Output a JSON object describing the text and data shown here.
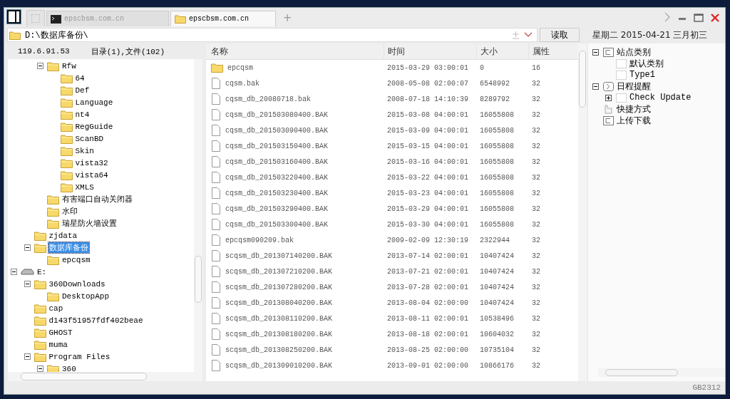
{
  "tabs": [
    {
      "kind": "blank",
      "selected": false
    },
    {
      "kind": "terminal",
      "label": "epscbsm.com.cn",
      "selected": false
    },
    {
      "kind": "folder",
      "label": "epscbsm.com.cn",
      "selected": true
    }
  ],
  "new_tab": "+",
  "address": {
    "path": "D:\\数据库备份\\",
    "button": "读取"
  },
  "date_line": "星期二 2015-04-21 三月初三",
  "left_panel": {
    "host": "119.6.91.53",
    "summary": "目录(1),文件(102)"
  },
  "tree": [
    {
      "children": [
        {
          "children": [
            {
              "label": "Rfw",
              "kind": "folder",
              "expanded": true,
              "selected": false,
              "children": [
                {
                  "label": "64",
                  "kind": "folder",
                  "selected": false
                },
                {
                  "label": "Def",
                  "kind": "folder",
                  "selected": false
                },
                {
                  "label": "Language",
                  "kind": "folder",
                  "selected": false
                },
                {
                  "label": "nt4",
                  "kind": "folder",
                  "selected": false
                },
                {
                  "label": "RegGuide",
                  "kind": "folder",
                  "selected": false
                },
                {
                  "label": "ScanBD",
                  "kind": "folder",
                  "selected": false
                },
                {
                  "label": "Skin",
                  "kind": "folder",
                  "selected": false
                },
                {
                  "label": "vista32",
                  "kind": "folder",
                  "selected": false
                },
                {
                  "label": "vista64",
                  "kind": "folder",
                  "selected": false
                },
                {
                  "label": "XMLS",
                  "kind": "folder",
                  "selected": false
                }
              ]
            },
            {
              "label": "有害端口自动关闭器",
              "kind": "folder",
              "selected": false
            },
            {
              "label": "水印",
              "kind": "folder",
              "selected": false
            },
            {
              "label": "瑞星防火墙设置",
              "kind": "folder",
              "selected": false
            }
          ]
        },
        {
          "label": "zjdata",
          "kind": "folder",
          "selected": false
        },
        {
          "label": "数据库备份",
          "kind": "folder",
          "expanded": true,
          "selected": true,
          "children": [
            {
              "label": "epcqsm",
              "kind": "folder",
              "selected": false
            }
          ]
        }
      ]
    },
    {
      "label": "E:",
      "kind": "drive",
      "expanded": true,
      "selected": false,
      "children": [
        {
          "label": "360Downloads",
          "kind": "folder",
          "expanded": true,
          "selected": false,
          "children": [
            {
              "label": "DesktopApp",
              "kind": "folder",
              "selected": false
            }
          ]
        },
        {
          "label": "cap",
          "kind": "folder",
          "selected": false
        },
        {
          "label": "d143f51957fdf402beae",
          "kind": "folder",
          "selected": false
        },
        {
          "label": "GHOST",
          "kind": "folder",
          "selected": false
        },
        {
          "label": "muma",
          "kind": "folder",
          "selected": false
        },
        {
          "label": "Program Files",
          "kind": "folder",
          "expanded": true,
          "selected": false,
          "children": [
            {
              "label": "360",
              "kind": "folder",
              "expanded": true,
              "selected": false
            }
          ]
        }
      ]
    }
  ],
  "table": {
    "columns": [
      "名称",
      "时间",
      "大小",
      "属性"
    ],
    "rows": [
      {
        "kind": "folder",
        "name": "epcqsm",
        "time": "2015-03-29 03:00:01",
        "size": "0",
        "attr": "16"
      },
      {
        "kind": "file",
        "name": "cqsm.bak",
        "time": "2008-05-08 02:00:07",
        "size": "6548992",
        "attr": "32"
      },
      {
        "kind": "file",
        "name": "cqsm_db_20080718.bak",
        "time": "2008-07-18 14:10:39",
        "size": "8289792",
        "attr": "32"
      },
      {
        "kind": "file",
        "name": "cqsm_db_201503080400.BAK",
        "time": "2015-03-08 04:00:01",
        "size": "16055808",
        "attr": "32"
      },
      {
        "kind": "file",
        "name": "cqsm_db_201503090400.BAK",
        "time": "2015-03-09 04:00:01",
        "size": "16055808",
        "attr": "32"
      },
      {
        "kind": "file",
        "name": "cqsm_db_201503150400.BAK",
        "time": "2015-03-15 04:00:01",
        "size": "16055808",
        "attr": "32"
      },
      {
        "kind": "file",
        "name": "cqsm_db_201503160400.BAK",
        "time": "2015-03-16 04:00:01",
        "size": "16055808",
        "attr": "32"
      },
      {
        "kind": "file",
        "name": "cqsm_db_201503220400.BAK",
        "time": "2015-03-22 04:00:01",
        "size": "16055808",
        "attr": "32"
      },
      {
        "kind": "file",
        "name": "cqsm_db_201503230400.BAK",
        "time": "2015-03-23 04:00:01",
        "size": "16055808",
        "attr": "32"
      },
      {
        "kind": "file",
        "name": "cqsm_db_201503290400.BAK",
        "time": "2015-03-29 04:00:01",
        "size": "16055808",
        "attr": "32"
      },
      {
        "kind": "file",
        "name": "cqsm_db_201503300400.BAK",
        "time": "2015-03-30 04:00:01",
        "size": "16055808",
        "attr": "32"
      },
      {
        "kind": "file",
        "name": "epcqsm090209.bak",
        "time": "2009-02-09 12:30:19",
        "size": "2322944",
        "attr": "32"
      },
      {
        "kind": "file",
        "name": "scqsm_db_201307140200.BAK",
        "time": "2013-07-14 02:00:01",
        "size": "10407424",
        "attr": "32"
      },
      {
        "kind": "file",
        "name": "scqsm_db_201307210200.BAK",
        "time": "2013-07-21 02:00:01",
        "size": "10407424",
        "attr": "32"
      },
      {
        "kind": "file",
        "name": "scqsm_db_201307280200.BAK",
        "time": "2013-07-28 02:00:01",
        "size": "10407424",
        "attr": "32"
      },
      {
        "kind": "file",
        "name": "scqsm_db_201308040200.BAK",
        "time": "2013-08-04 02:00:00",
        "size": "10407424",
        "attr": "32"
      },
      {
        "kind": "file",
        "name": "scqsm_db_201308110200.BAK",
        "time": "2013-08-11 02:00:01",
        "size": "10538496",
        "attr": "32"
      },
      {
        "kind": "file",
        "name": "scqsm_db_201308180200.BAK",
        "time": "2013-08-18 02:00:01",
        "size": "10604032",
        "attr": "32"
      },
      {
        "kind": "file",
        "name": "scqsm_db_201308250200.BAK",
        "time": "2013-08-25 02:00:00",
        "size": "10735104",
        "attr": "32"
      },
      {
        "kind": "file",
        "name": "scqsm_db_201309010200.BAK",
        "time": "2013-09-01 02:00:00",
        "size": "10866176",
        "attr": "32"
      }
    ]
  },
  "side_tree": [
    {
      "label": "站点类别",
      "kind": "category",
      "expanded": true,
      "children": [
        {
          "label": "默认类别",
          "kind": "item"
        },
        {
          "label": "Type1",
          "kind": "item"
        }
      ]
    },
    {
      "label": "日程提醒",
      "kind": "schedule",
      "expanded": true,
      "children": [
        {
          "label": "Check Update",
          "kind": "item",
          "expanded": false
        }
      ]
    },
    {
      "label": "快捷方式",
      "kind": "shortcut"
    },
    {
      "label": "上传下载",
      "kind": "category"
    }
  ],
  "status_bar": {
    "encoding": "GB2312"
  }
}
